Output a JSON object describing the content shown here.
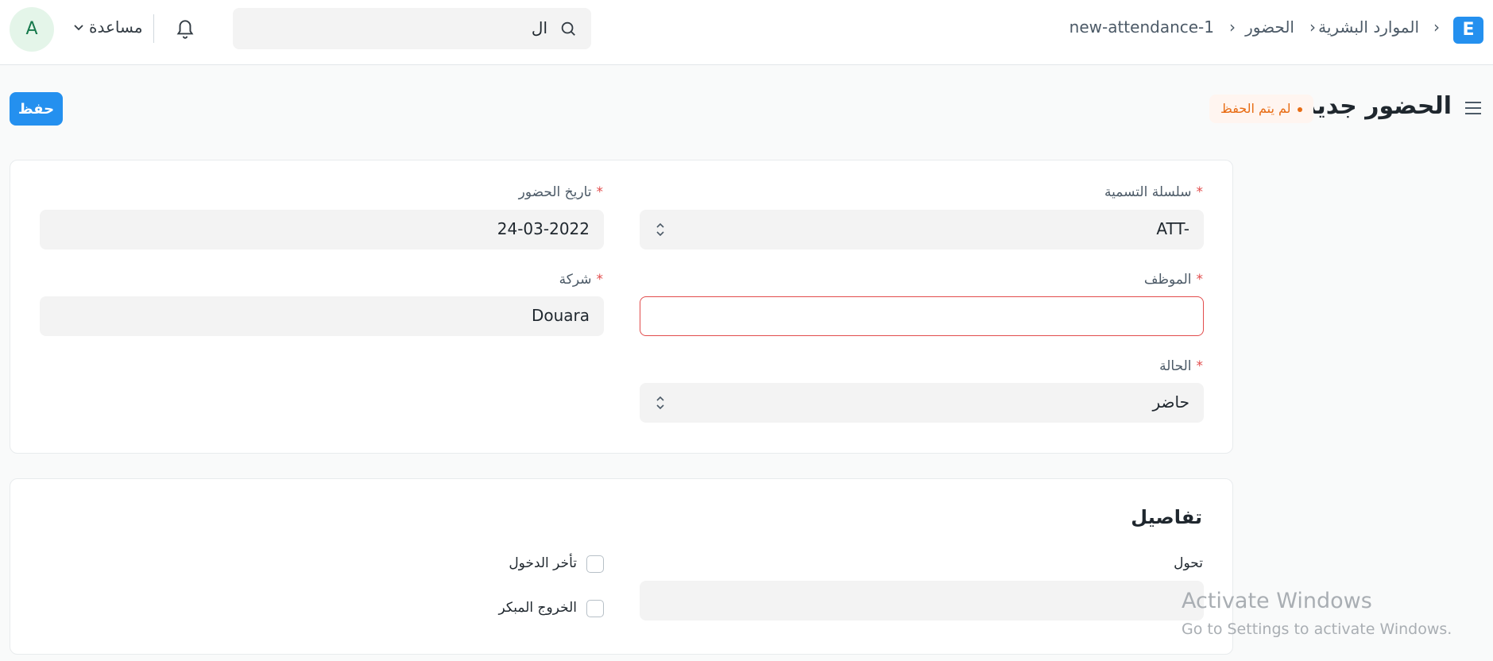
{
  "header": {
    "logo_letter": "E",
    "breadcrumbs": [
      "الموارد البشرية",
      "الحضور",
      "new-attendance-1"
    ],
    "search_text": "ال",
    "help_label": "مساعدة",
    "avatar_letter": "A"
  },
  "page": {
    "title": "الحضور جديد",
    "status": "لم يتم الحفظ",
    "save_label": "حفظ"
  },
  "form": {
    "naming_series": {
      "label": "سلسلة التسمية",
      "value": "ATT-"
    },
    "attendance_date": {
      "label": "تاريخ الحضور",
      "value": "24-03-2022"
    },
    "employee": {
      "label": "الموظف",
      "value": ""
    },
    "company": {
      "label": "شركة",
      "value": "Douara"
    },
    "status": {
      "label": "الحالة",
      "value": "حاضر"
    },
    "required_mark": "*"
  },
  "details": {
    "title": "تفاصيل",
    "shift_label": "تحول",
    "shift_value": "",
    "late_entry_label": "تأخر الدخول",
    "early_exit_label": "الخروج المبكر"
  },
  "watermark": {
    "line1": "Activate Windows",
    "line2": "Go to Settings to activate Windows."
  },
  "colors": {
    "primary": "#2490ef",
    "warning": "#e86c13",
    "error": "#e24c4c"
  }
}
